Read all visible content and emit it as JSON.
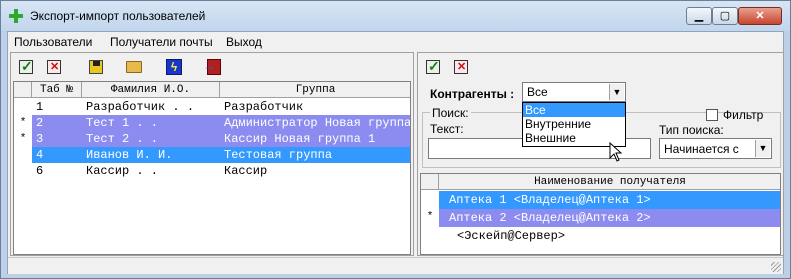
{
  "window": {
    "title": "Экспорт-импорт пользователей"
  },
  "menu": {
    "items": [
      "Пользователи",
      "Получатели почты",
      "Выход"
    ]
  },
  "users_grid": {
    "columns": [
      "Таб №",
      "Фамилия И.О.",
      "Группа"
    ],
    "rows": [
      {
        "marker": "",
        "tab": "1",
        "name": "Разработчик . .",
        "group": "Разработчик",
        "state": "normal"
      },
      {
        "marker": "*",
        "tab": "2",
        "name": "Тест 1 . .",
        "group": "Администратор Новая группа",
        "state": "marked"
      },
      {
        "marker": "*",
        "tab": "3",
        "name": "Тест 2 . .",
        "group": "Кассир Новая группа 1",
        "state": "marked"
      },
      {
        "marker": "",
        "tab": "4",
        "name": "Иванов И. И.",
        "group": "Тестовая группа",
        "state": "selected"
      },
      {
        "marker": "",
        "tab": "6",
        "name": "Кассир . .",
        "group": "Кассир",
        "state": "normal"
      }
    ]
  },
  "filter": {
    "contractors_label": "Контрагенты :",
    "contractors_value": "Все",
    "contractors_options": [
      "Все",
      "Внутренние",
      "Внешние"
    ],
    "search_group_label": "Поиск:",
    "filter_checkbox_label": "Фильтр",
    "filter_checked": false,
    "text_label": "Текст:",
    "text_value": "",
    "search_type_label": "Тип поиска:",
    "search_type_value": "Начинается с"
  },
  "recipients_grid": {
    "column": "Наименование получателя",
    "rows": [
      {
        "marker": "",
        "name": "Аптека 1 <Владелец@Аптека 1>",
        "state": "selected"
      },
      {
        "marker": "*",
        "name": "Аптека 2 <Владелец@Аптека 2>",
        "state": "marked"
      },
      {
        "marker": "",
        "name": "<Эскейп@Сервер>",
        "state": "normal"
      }
    ]
  },
  "colors": {
    "selected": "#3399ff",
    "marked": "#8c8cf0",
    "selected_text": "#ffffff"
  },
  "icons": {
    "left_toolbar": [
      "check-icon",
      "delete-icon",
      "save-icon",
      "open-folder-icon",
      "lightning-icon",
      "exit-icon"
    ],
    "right_toolbar": [
      "check-icon",
      "delete-icon"
    ]
  }
}
